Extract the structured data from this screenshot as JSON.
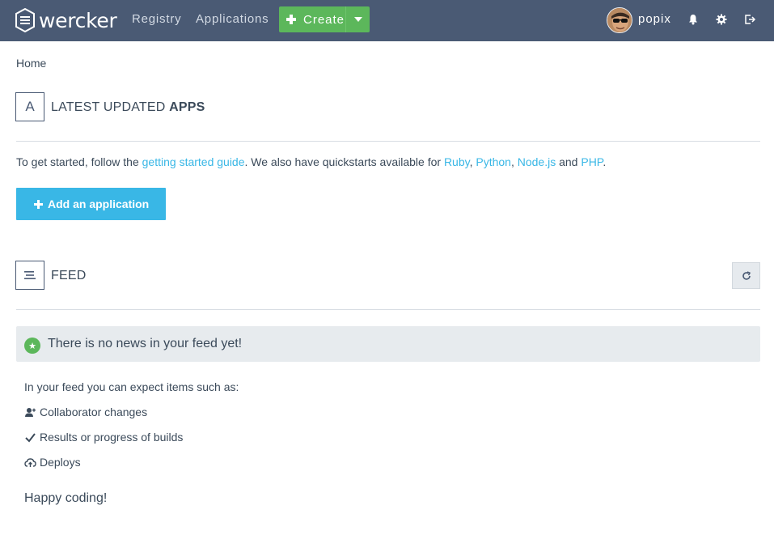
{
  "header": {
    "logo_text": "wercker",
    "nav": [
      "Registry",
      "Applications"
    ],
    "create_label": "Create",
    "username": "popix",
    "colors": {
      "background": "#4a5a74",
      "create": "#5cb75b"
    },
    "icons": [
      "bell-icon",
      "gear-icon",
      "logout-icon"
    ]
  },
  "breadcrumb": "Home",
  "apps_section": {
    "icon_letter": "A",
    "title_prefix": "LATEST UPDATED ",
    "title_bold": "APPS",
    "intro": {
      "before": "To get started, follow the ",
      "guide_link": "getting started guide",
      "middle": ". We also have quickstarts available for ",
      "ruby": "Ruby",
      "sep1": ", ",
      "python": "Python",
      "sep2": ", ",
      "node": "Node.js",
      "and": " and ",
      "php": "PHP",
      "end": "."
    },
    "add_button": "Add an application",
    "accent": "#39b7e6"
  },
  "feed_section": {
    "title": "FEED",
    "notice": "There is no news in your feed yet!",
    "expect_text": "In your feed you can expect items such as:",
    "items": [
      {
        "label": "Collaborator changes",
        "icon": "add-user-icon"
      },
      {
        "label": "Results or progress of builds",
        "icon": "check-icon"
      },
      {
        "label": "Deploys",
        "icon": "cloud-upload-icon"
      }
    ],
    "closing": "Happy coding!"
  }
}
